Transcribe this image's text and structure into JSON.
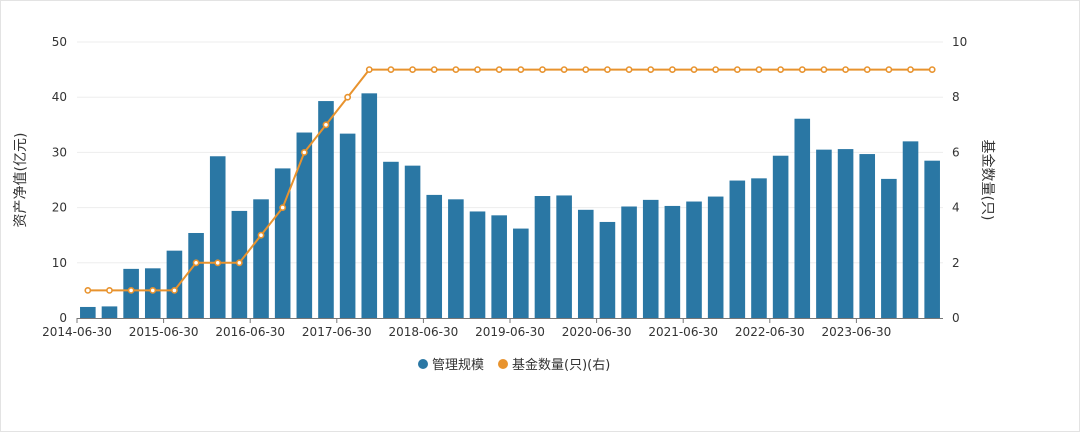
{
  "colors": {
    "bar": "#2a77a4",
    "line": "#e8932e",
    "grid": "#ededed",
    "axis": "#777777"
  },
  "chart_data": {
    "type": "bar",
    "y_left_label": "资产净值(亿元)",
    "y_right_label": "基金数量(只)",
    "ylim_left": [
      0,
      50
    ],
    "ylim_right": [
      0,
      10
    ],
    "y_left_ticks": [
      "0",
      "10",
      "20",
      "30",
      "40",
      "50"
    ],
    "y_right_ticks": [
      "0",
      "2",
      "4",
      "6",
      "8",
      "10"
    ],
    "x_tick_labels": [
      "2014-06-30",
      "2015-06-30",
      "2016-06-30",
      "2017-06-30",
      "2018-06-30",
      "2019-06-30",
      "2020-06-30",
      "2021-06-30",
      "2022-06-30",
      "2023-06-30"
    ],
    "grid": true,
    "legend_position": "bottom",
    "categories": [
      "2014-06-30",
      "2014-09-30",
      "2014-12-31",
      "2015-03-31",
      "2015-06-30",
      "2015-09-30",
      "2015-12-31",
      "2016-03-31",
      "2016-06-30",
      "2016-09-30",
      "2016-12-31",
      "2017-03-31",
      "2017-06-30",
      "2017-09-30",
      "2017-12-31",
      "2018-03-31",
      "2018-06-30",
      "2018-09-30",
      "2018-12-31",
      "2019-03-31",
      "2019-06-30",
      "2019-09-30",
      "2019-12-31",
      "2020-03-31",
      "2020-06-30",
      "2020-09-30",
      "2020-12-31",
      "2021-03-31",
      "2021-06-30",
      "2021-09-30",
      "2021-12-31",
      "2022-03-31",
      "2022-06-30",
      "2022-09-30",
      "2022-12-31",
      "2023-03-31",
      "2023-06-30",
      "2023-09-30",
      "2023-12-31",
      "2024-03-31"
    ],
    "series": [
      {
        "name": "管理规模",
        "type": "bar",
        "axis": "left",
        "values": [
          2.0,
          2.1,
          8.9,
          9.0,
          12.2,
          15.4,
          29.3,
          19.4,
          21.5,
          27.1,
          33.6,
          39.3,
          33.4,
          40.7,
          28.3,
          27.6,
          22.3,
          21.5,
          19.3,
          18.6,
          16.2,
          22.1,
          22.2,
          19.6,
          17.4,
          20.2,
          21.4,
          20.3,
          21.1,
          22.0,
          24.9,
          25.3,
          29.4,
          36.1,
          30.5,
          30.6,
          29.7,
          25.2,
          32.0,
          28.5
        ]
      },
      {
        "name": "基金数量(只)(右)",
        "type": "line",
        "axis": "right",
        "values": [
          1,
          1,
          1,
          1,
          1,
          2,
          2,
          2,
          3,
          4,
          6,
          7,
          8,
          9,
          9,
          9,
          9,
          9,
          9,
          9,
          9,
          9,
          9,
          9,
          9,
          9,
          9,
          9,
          9,
          9,
          9,
          9,
          9,
          9,
          9,
          9,
          9,
          9,
          9,
          9
        ]
      }
    ]
  }
}
